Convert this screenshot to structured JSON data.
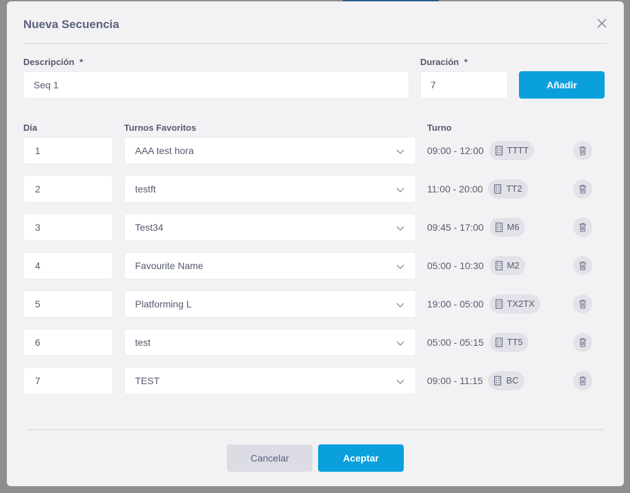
{
  "modal": {
    "title": "Nueva Secuencia"
  },
  "form": {
    "descripcion_label": "Descripción",
    "descripcion_value": "Seq 1",
    "duracion_label": "Duración",
    "duracion_value": "7",
    "required_mark": "*",
    "add_button": "Añadir"
  },
  "columns": {
    "dia": "Día",
    "turnos_favoritos": "Turnos Favoritos",
    "turno": "Turno"
  },
  "rows": [
    {
      "day": "1",
      "favorite": "AAA test hora",
      "time": "09:00 - 12:00",
      "code": "TTTT"
    },
    {
      "day": "2",
      "favorite": "testft",
      "time": "11:00 - 20:00",
      "code": "TT2"
    },
    {
      "day": "3",
      "favorite": "Test34",
      "time": "09:45 - 17:00",
      "code": "M6"
    },
    {
      "day": "4",
      "favorite": "Favourite Name",
      "time": "05:00 - 10:30",
      "code": "M2"
    },
    {
      "day": "5",
      "favorite": "Platforming L",
      "time": "19:00 - 05:00",
      "code": "TX2TX"
    },
    {
      "day": "6",
      "favorite": "test",
      "time": "05:00 - 05:15",
      "code": "TT5"
    },
    {
      "day": "7",
      "favorite": "TEST",
      "time": "09:00 - 11:15",
      "code": "BC"
    }
  ],
  "footer": {
    "cancel": "Cancelar",
    "accept": "Aceptar"
  },
  "colors": {
    "primary": "#0aa0dc",
    "title": "#5a607f",
    "background": "#f2f2f4"
  },
  "icons": {
    "close": "close-icon",
    "chevron": "chevron-down-icon",
    "building": "building-icon",
    "trash": "trash-icon"
  }
}
